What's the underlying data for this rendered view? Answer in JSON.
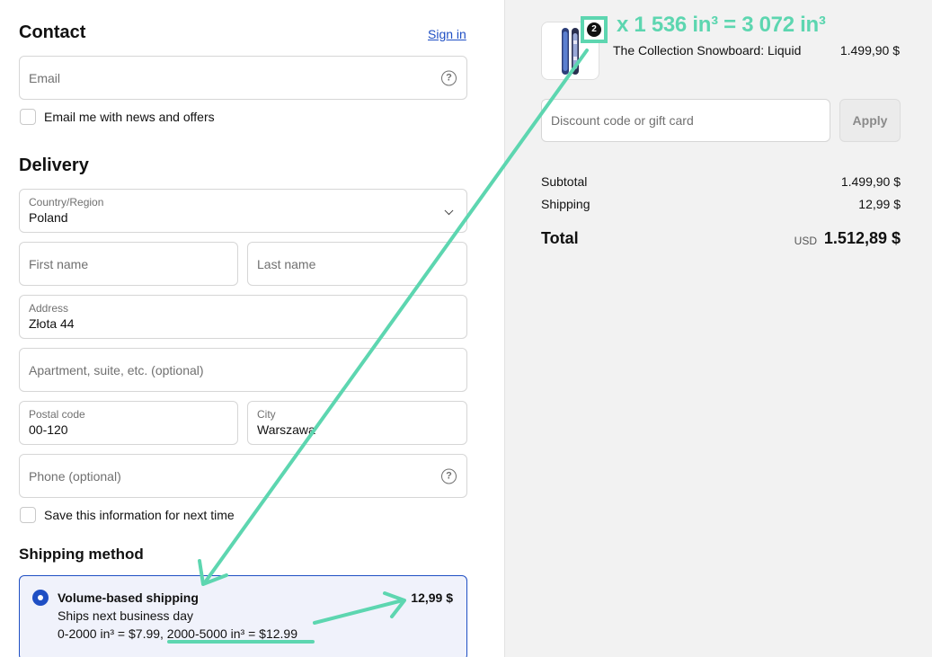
{
  "contact": {
    "heading": "Contact",
    "sign_in": "Sign in",
    "email_placeholder": "Email",
    "news_label": "Email me with news and offers"
  },
  "delivery": {
    "heading": "Delivery",
    "country_label": "Country/Region",
    "country_value": "Poland",
    "first_name_placeholder": "First name",
    "last_name_placeholder": "Last name",
    "address_label": "Address",
    "address_value": "Złota 44",
    "apartment_placeholder": "Apartment, suite, etc. (optional)",
    "postal_label": "Postal code",
    "postal_value": "00-120",
    "city_label": "City",
    "city_value": "Warszawa",
    "phone_placeholder": "Phone (optional)",
    "save_label": "Save this information for next time"
  },
  "shipping": {
    "heading": "Shipping method",
    "option_title": "Volume-based shipping",
    "option_subtitle": "Ships next business day",
    "option_rates": "0-2000 in³ = $7.99, 2000-5000 in³ = $12.99",
    "option_price": "12,99 $"
  },
  "cart": {
    "quantity": "2",
    "product_name": "The Collection Snowboard: Liquid",
    "product_price": "1.499,90 $",
    "annotation": "x 1 536 in³ = 3 072 in³",
    "discount_placeholder": "Discount code or gift card",
    "apply_label": "Apply",
    "subtotal_label": "Subtotal",
    "subtotal_value": "1.499,90 $",
    "shipping_label": "Shipping",
    "shipping_value": "12,99 $",
    "total_label": "Total",
    "total_currency": "USD",
    "total_value": "1.512,89 $"
  },
  "colors": {
    "accent": "#1f4fc4",
    "annotation": "#5dd6b0",
    "summary_bg": "#f2f2f2"
  }
}
